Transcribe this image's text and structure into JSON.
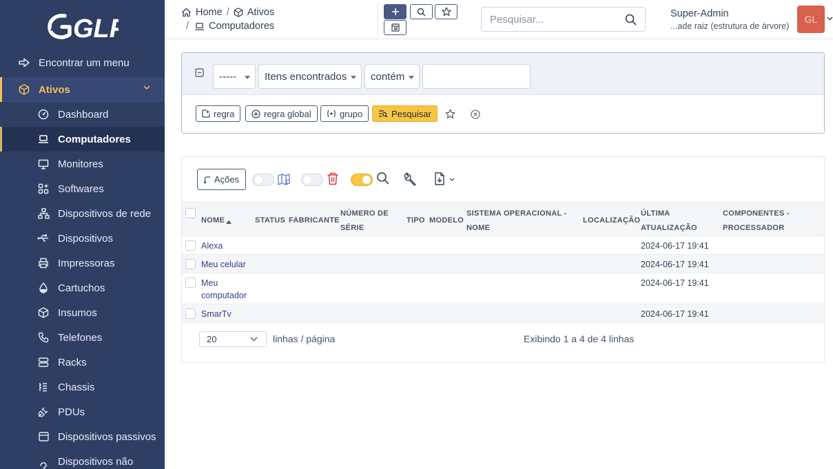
{
  "app": {
    "logo_text": "GLPI"
  },
  "sidebar": {
    "find_menu": "Encontrar um menu",
    "group": "Ativos",
    "items": [
      {
        "label": "Dashboard",
        "icon": "gauge-icon"
      },
      {
        "label": "Computadores",
        "icon": "laptop-icon",
        "active": true
      },
      {
        "label": "Monitores",
        "icon": "monitor-icon"
      },
      {
        "label": "Softwares",
        "icon": "apps-icon"
      },
      {
        "label": "Dispositivos de rede",
        "icon": "network-icon"
      },
      {
        "label": "Dispositivos",
        "icon": "usb-icon"
      },
      {
        "label": "Impressoras",
        "icon": "printer-icon"
      },
      {
        "label": "Cartuchos",
        "icon": "droplet-icon"
      },
      {
        "label": "Insumos",
        "icon": "package-icon"
      },
      {
        "label": "Telefones",
        "icon": "phone-icon"
      },
      {
        "label": "Racks",
        "icon": "server-icon"
      },
      {
        "label": "Chassis",
        "icon": "columns-icon"
      },
      {
        "label": "PDUs",
        "icon": "plug-icon"
      },
      {
        "label": "Dispositivos passivos",
        "icon": "box-icon"
      },
      {
        "label": "Dispositivos não",
        "icon": "question-icon"
      }
    ]
  },
  "breadcrumb": {
    "home": "Home",
    "sep": "/",
    "section": "Ativos",
    "page": "Computadores"
  },
  "search": {
    "placeholder": "Pesquisar..."
  },
  "user": {
    "name": "Super-Admin",
    "entity": "...ade raiz (estrutura de árvore)",
    "initials": "GL"
  },
  "criteria": {
    "link": "-----",
    "field": "Itens encontrados",
    "operator": "contém",
    "value": "",
    "buttons": {
      "rule": "regra",
      "global_rule": "regra global",
      "group": "grupo",
      "search": "Pesquisar"
    }
  },
  "results": {
    "actions_label": "Ações",
    "columns": [
      "NOME",
      "STATUS",
      "FABRICANTE",
      "NÚMERO DE SÉRIE",
      "TIPO",
      "MODELO",
      "SISTEMA OPERACIONAL - NOME",
      "LOCALIZAÇÃO",
      "ÚLTIMA ATUALIZAÇÃO",
      "COMPONENTES - PROCESSADOR"
    ],
    "rows": [
      {
        "name": "Alexa",
        "updated": "2024-06-17 19:41"
      },
      {
        "name": "Meu celular",
        "updated": "2024-06-17 19:41"
      },
      {
        "name": "Meu computador",
        "updated": "2024-06-17 19:41"
      },
      {
        "name": "SmarTv",
        "updated": "2024-06-17 19:41"
      }
    ],
    "pager": {
      "per_page": "20",
      "per_page_label": "linhas / página",
      "count_text": "Exibindo 1 a 4 de 4 linhas"
    }
  },
  "colors": {
    "sidebar_bg": "#2f3f64",
    "accent": "#f4c05a",
    "search_button": "#f8c544",
    "avatar": "#d9604c",
    "link": "#2f4486"
  }
}
